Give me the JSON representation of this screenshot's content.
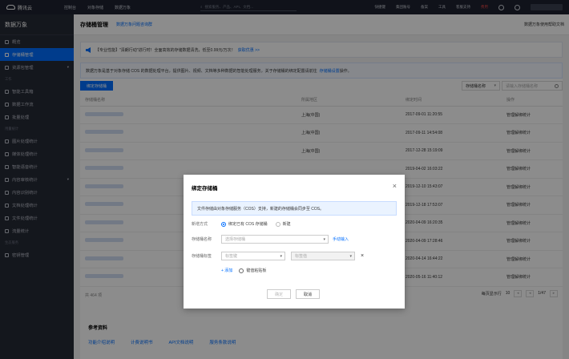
{
  "topnav": {
    "logo": "腾讯云",
    "links": [
      "控制台",
      "对象存储",
      "数据万象"
    ],
    "search_placeholder": "搜索服务、产品、API、文档...",
    "right": [
      "快捷键",
      "集团账号",
      "备案",
      "工具",
      "客服支持",
      "费用"
    ]
  },
  "sidebar": {
    "title": "数据万象",
    "items": [
      {
        "label": "概览",
        "active": false,
        "chev": ""
      },
      {
        "label": "存储桶管理",
        "active": true,
        "chev": ""
      },
      {
        "label": "资源包管理",
        "active": false,
        "chev": "▾"
      }
    ],
    "group1": "工作",
    "items2": [
      {
        "label": "智能工具箱",
        "chev": ""
      },
      {
        "label": "数据工作流",
        "chev": ""
      },
      {
        "label": "批量处理",
        "chev": ""
      }
    ],
    "group2": "用量统计",
    "items3": [
      {
        "label": "图片处理统计",
        "chev": ""
      },
      {
        "label": "媒体处理统计",
        "chev": ""
      },
      {
        "label": "智能语音统计",
        "chev": ""
      },
      {
        "label": "内容审核统计",
        "chev": "▾"
      },
      {
        "label": "内容识别统计",
        "chev": ""
      },
      {
        "label": "文档处理统计",
        "chev": ""
      },
      {
        "label": "文件处理统计",
        "chev": ""
      },
      {
        "label": "流量统计",
        "chev": ""
      }
    ],
    "group3": "生态服务",
    "items4": [
      {
        "label": "密钥管理",
        "chev": ""
      }
    ]
  },
  "header": {
    "title": "存储桶管理",
    "link": "数据万象问题咨询群",
    "right": "数据万象使用帮助文档"
  },
  "notice": {
    "text": "【专业性能】\"清朗行动\"进行时！全面高效的存储数据清洗，低至0.99元/万次！",
    "link": "获取优惠 >>"
  },
  "infobar": {
    "text": "数据万象是基于对象存储 COS 的数据处理平台，提供图片、视频、文档等多种数据的智能处理服务，关于存储桶的绑定配置请前往",
    "link": "存储桶设置",
    "suffix": "操作。"
  },
  "toolbar": {
    "bind_button": "绑定存储桶",
    "filter_label": "存储桶名称",
    "search_placeholder": "请输入存储桶名称"
  },
  "table": {
    "headers": [
      "存储桶名称",
      "所属地区",
      "绑定时间",
      "操作"
    ],
    "rows": [
      {
        "region": "上海(中国)",
        "time": "2017-09-01 11:20:55"
      },
      {
        "region": "上海(中国)",
        "time": "2017-09-11 14:54:08"
      },
      {
        "region": "上海(中国)",
        "time": "2017-12-28 15:19:09"
      },
      {
        "region": "",
        "time": "2019-04-02 16:03:22"
      },
      {
        "region": "",
        "time": "2019-12-10 15:43:07"
      },
      {
        "region": "",
        "time": "2019-12-18 17:53:07"
      },
      {
        "region": "",
        "time": "2020-04-09 16:20:35"
      },
      {
        "region": "",
        "time": "2020-04-09 17:28:46"
      },
      {
        "region": "",
        "time": "2020-04-14 16:44:22"
      },
      {
        "region": "",
        "time": "2020-05-16 11:40:12"
      }
    ],
    "ops": [
      "管理",
      "解绑",
      "统计"
    ],
    "total": "共 464 项",
    "per_page_label": "每页显示行",
    "per_page": "10",
    "page": "1/47"
  },
  "refs": {
    "title": "参考资料",
    "links": [
      "功能介绍说明",
      "计费说明书",
      "API文档说明",
      "服务条款说明"
    ]
  },
  "dialog": {
    "title": "绑定存储桶",
    "info": "文件存储由对象存储服务（COS）支持，新建的存储桶会同步至 COS。",
    "mode_label": "新增方式",
    "mode_options": [
      "绑定已有 COS 存储桶",
      "新建"
    ],
    "bucket_label": "存储桶名称",
    "bucket_placeholder": "选择存储桶",
    "manual_input": "手动输入",
    "tag_label": "存储桶标签",
    "tag_key_placeholder": "标签键",
    "tag_value_placeholder": "标签值",
    "add": "+ 添加",
    "paste": "键值粘贴板",
    "confirm": "确定",
    "cancel": "取消"
  }
}
